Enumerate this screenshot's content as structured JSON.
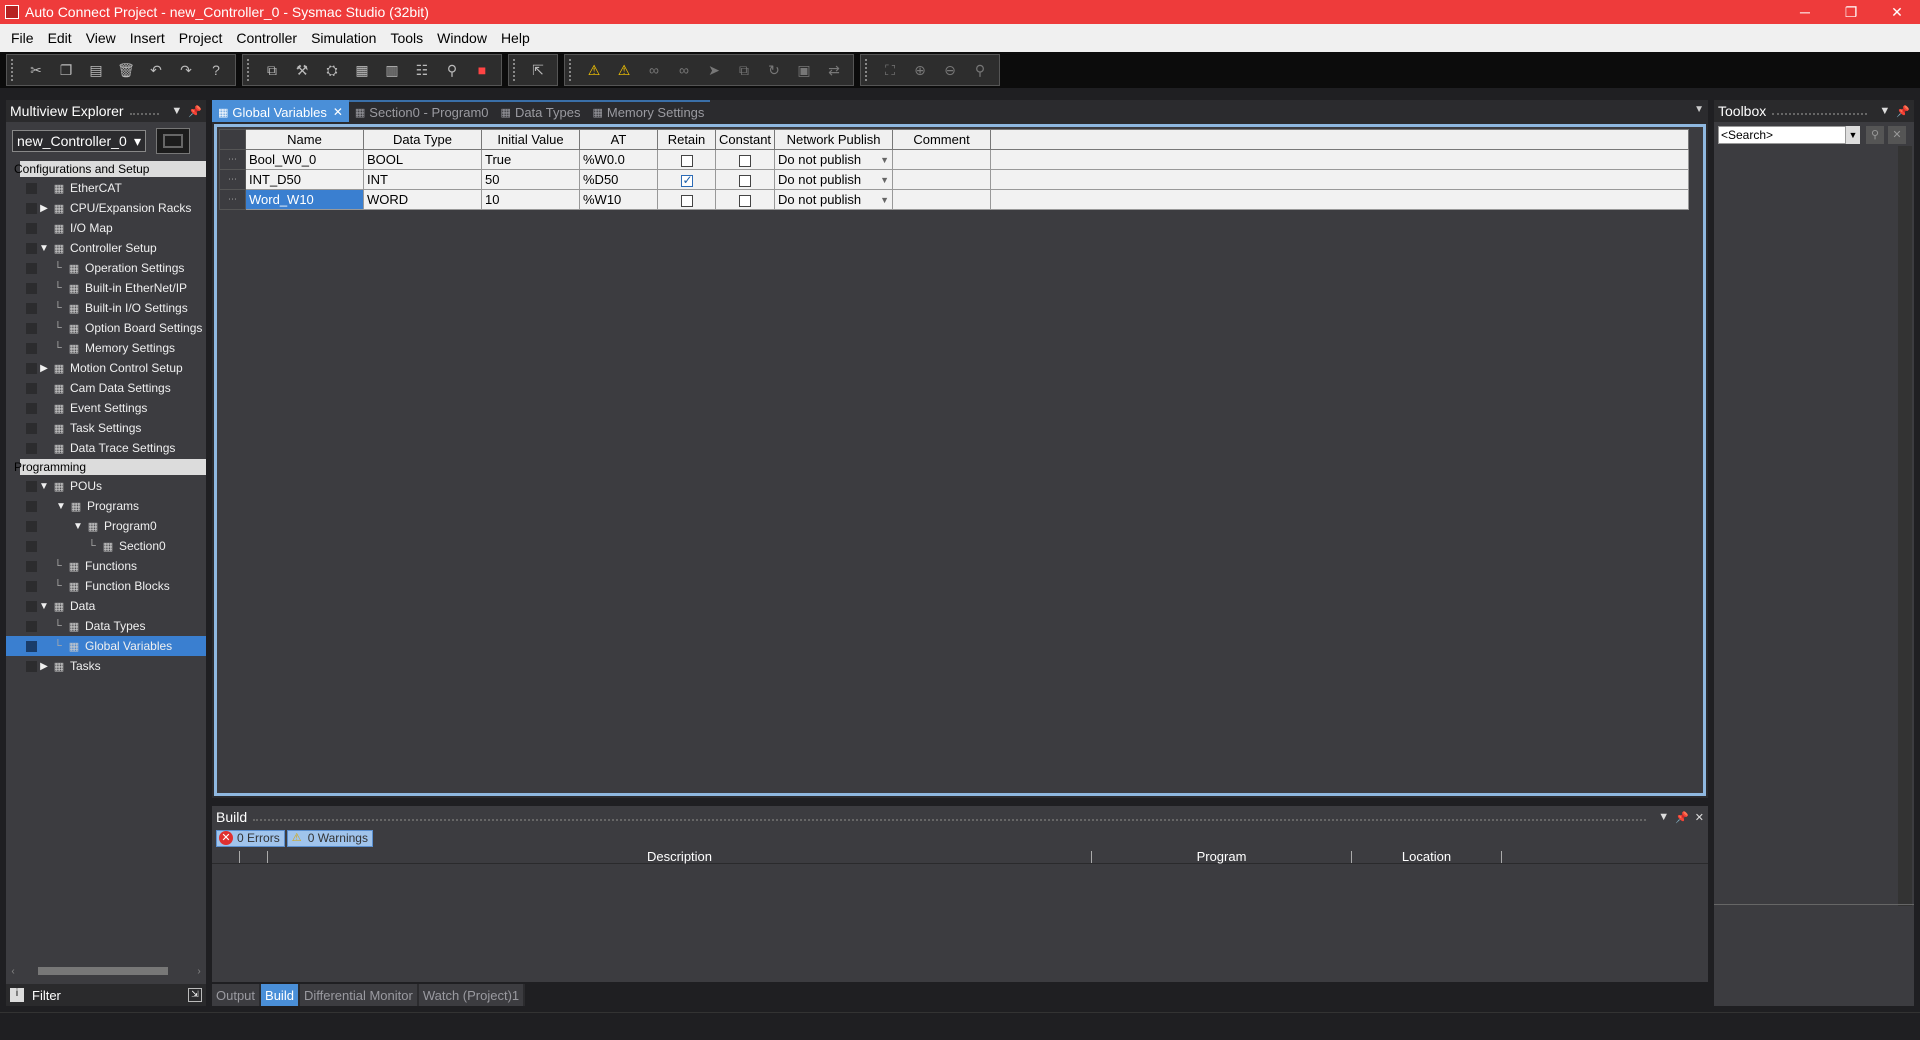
{
  "window": {
    "title": "Auto Connect Project - new_Controller_0 - Sysmac Studio (32bit)",
    "minimize": "─",
    "restore": "❐",
    "close": "✕"
  },
  "menu": [
    "File",
    "Edit",
    "View",
    "Insert",
    "Project",
    "Controller",
    "Simulation",
    "Tools",
    "Window",
    "Help"
  ],
  "explorer": {
    "title": "Multiview Explorer",
    "controller": "new_Controller_0",
    "tree": [
      {
        "label": "Configurations and Setup",
        "section": true,
        "arrow": "▼",
        "indent": 0
      },
      {
        "label": "EtherCAT",
        "icon": "ethercat-icon",
        "indent": 1
      },
      {
        "label": "CPU/Expansion Racks",
        "icon": "rack-icon",
        "arrow": "▶",
        "indent": 1
      },
      {
        "label": "I/O Map",
        "icon": "io-map-icon",
        "indent": 1
      },
      {
        "label": "Controller Setup",
        "icon": "controller-setup-icon",
        "arrow": "▼",
        "indent": 1
      },
      {
        "label": "Operation Settings",
        "icon": "settings-icon",
        "leaf": true,
        "indent": 2
      },
      {
        "label": "Built-in EtherNet/IP",
        "icon": "network-icon",
        "leaf": true,
        "indent": 2
      },
      {
        "label": "Built-in I/O Settings",
        "icon": "io-icon",
        "leaf": true,
        "indent": 2
      },
      {
        "label": "Option Board Settings",
        "icon": "board-icon",
        "leaf": true,
        "indent": 2
      },
      {
        "label": "Memory Settings",
        "icon": "memory-icon",
        "leaf": true,
        "indent": 2
      },
      {
        "label": "Motion Control Setup",
        "icon": "motion-icon",
        "arrow": "▶",
        "indent": 1
      },
      {
        "label": "Cam Data Settings",
        "icon": "cam-icon",
        "indent": 1
      },
      {
        "label": "Event Settings",
        "icon": "event-flag-icon",
        "indent": 1
      },
      {
        "label": "Task Settings",
        "icon": "task-icon",
        "indent": 1
      },
      {
        "label": "Data Trace Settings",
        "icon": "trace-icon",
        "indent": 1
      },
      {
        "label": "Programming",
        "section": true,
        "arrow": "▼",
        "indent": 0
      },
      {
        "label": "POUs",
        "icon": "pou-icon",
        "arrow": "▼",
        "indent": 1
      },
      {
        "label": "Programs",
        "icon": "programs-icon",
        "arrow": "▼",
        "indent": 2
      },
      {
        "label": "Program0",
        "icon": "program-icon",
        "arrow": "▼",
        "indent": 3
      },
      {
        "label": "Section0",
        "icon": "section-icon",
        "leaf": true,
        "indent": 4
      },
      {
        "label": "Functions",
        "icon": "functions-icon",
        "leaf": true,
        "indent": 2
      },
      {
        "label": "Function Blocks",
        "icon": "function-blocks-icon",
        "leaf": true,
        "indent": 2
      },
      {
        "label": "Data",
        "icon": "data-icon",
        "arrow": "▼",
        "indent": 1
      },
      {
        "label": "Data Types",
        "icon": "data-types-icon",
        "leaf": true,
        "indent": 2
      },
      {
        "label": "Global Variables",
        "icon": "global-variables-icon",
        "leaf": true,
        "indent": 2,
        "selected": true
      },
      {
        "label": "Tasks",
        "icon": "tasks-icon",
        "arrow": "▶",
        "indent": 1
      }
    ],
    "filter_label": "Filter"
  },
  "tabs": [
    {
      "label": "Global Variables",
      "active": true
    },
    {
      "label": "Section0 - Program0"
    },
    {
      "label": "Data Types"
    },
    {
      "label": "Memory Settings"
    }
  ],
  "variables": {
    "headers": [
      "Name",
      "Data Type",
      "Initial Value",
      "AT",
      "Retain",
      "Constant",
      "Network Publish",
      "Comment"
    ],
    "rows": [
      {
        "name": "Bool_W0_0",
        "type": "BOOL",
        "initial": "True",
        "at": "%W0.0",
        "retain": false,
        "constant": false,
        "publish": "Do not publish"
      },
      {
        "name": "INT_D50",
        "type": "INT",
        "initial": "50",
        "at": "%D50",
        "retain": true,
        "constant": false,
        "publish": "Do not publish"
      },
      {
        "name": "Word_W10",
        "type": "WORD",
        "initial": "10",
        "at": "%W10",
        "retain": false,
        "constant": false,
        "publish": "Do not publish",
        "selected": true
      }
    ]
  },
  "build": {
    "title": "Build",
    "errors_count": "0",
    "errors_label": "Errors",
    "warnings_count": "0",
    "warnings_label": "Warnings",
    "columns": [
      "Description",
      "Program",
      "Location"
    ]
  },
  "bottom_tabs": [
    {
      "label": "Output"
    },
    {
      "label": "Build",
      "active": true
    },
    {
      "label": "Differential Monitor"
    },
    {
      "label": "Watch (Project)1"
    }
  ],
  "toolbox": {
    "title": "Toolbox",
    "search_placeholder": "<Search>"
  }
}
